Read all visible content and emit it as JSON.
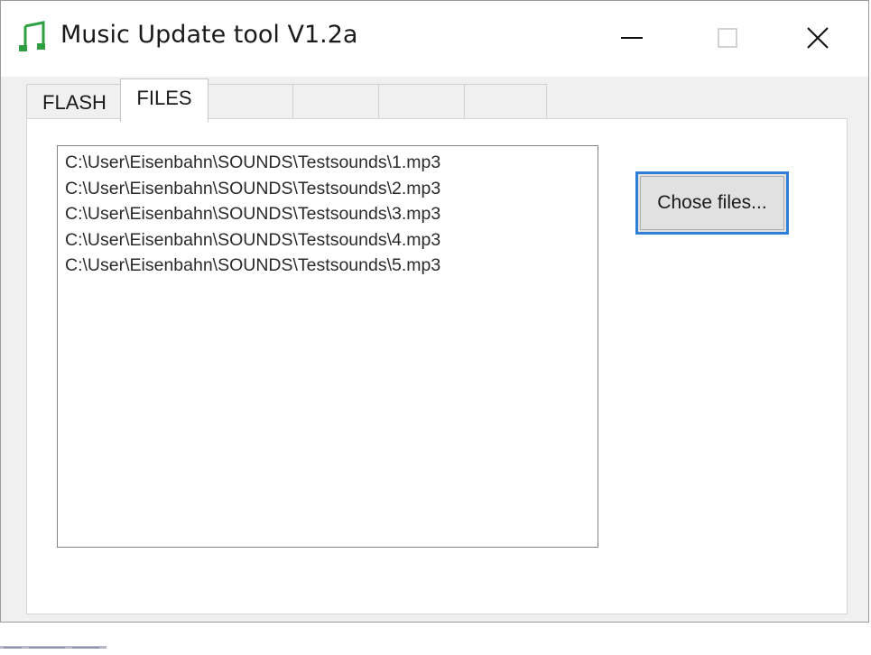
{
  "window": {
    "title": "Music Update tool V1.2a",
    "icon": "music-note-icon",
    "controls": [
      "minimize-icon",
      "maximize-icon",
      "close-icon"
    ]
  },
  "tabs": [
    {
      "label": "FLASH",
      "selected": false
    },
    {
      "label": "FILES",
      "selected": true
    },
    {
      "label": "",
      "selected": false
    },
    {
      "label": "",
      "selected": false
    },
    {
      "label": "",
      "selected": false
    },
    {
      "label": "",
      "selected": false
    }
  ],
  "files": {
    "items": [
      "C:\\User\\Eisenbahn\\SOUNDS\\Testsounds\\1.mp3",
      "C:\\User\\Eisenbahn\\SOUNDS\\Testsounds\\2.mp3",
      "C:\\User\\Eisenbahn\\SOUNDS\\Testsounds\\3.mp3",
      "C:\\User\\Eisenbahn\\SOUNDS\\Testsounds\\4.mp3",
      "C:\\User\\Eisenbahn\\SOUNDS\\Testsounds\\5.mp3"
    ],
    "chose_button_label": "Chose files..."
  },
  "colors": {
    "accent_focus": "#2f7fd6",
    "icon_green": "#2ea043",
    "window_bg": "#f0f0f0"
  }
}
